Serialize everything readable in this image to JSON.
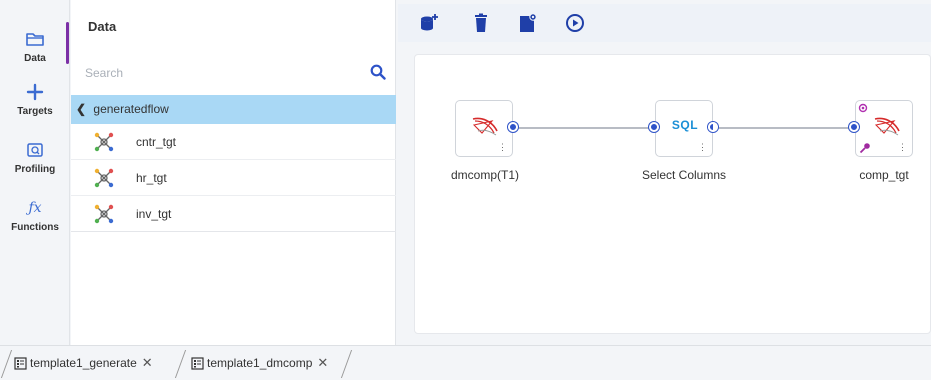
{
  "rail": {
    "items": [
      {
        "label": "Data",
        "icon": "folder-icon"
      },
      {
        "label": "Targets",
        "icon": "plus-icon"
      },
      {
        "label": "Profiling",
        "icon": "profiling-icon"
      },
      {
        "label": "Functions",
        "icon": "function-icon"
      }
    ],
    "function_glyph": "ƒx"
  },
  "panel": {
    "title": "Data",
    "search_placeholder": "Search",
    "flow": {
      "chevron": "❮",
      "name": "generatedflow"
    },
    "targets": [
      "cntr_tgt",
      "hr_tgt",
      "inv_tgt"
    ]
  },
  "toolbar": {
    "buttons": [
      "add-database-icon",
      "delete-icon",
      "database-settings-icon",
      "run-icon"
    ]
  },
  "canvas": {
    "nodes": [
      {
        "label": "dmcomp(T1)",
        "kind": "sql-server-source"
      },
      {
        "label": "Select Columns",
        "kind": "sql-transform",
        "badge": "SQL"
      },
      {
        "label": "comp_tgt",
        "kind": "sql-server-target"
      }
    ],
    "node_menu_glyph": "⋮"
  },
  "tabs": [
    {
      "label": "template1_generate",
      "close": "✕"
    },
    {
      "label": "template1_dmcomp",
      "close": "✕"
    }
  ],
  "colors": {
    "accent": "#7b2fa6",
    "primary": "#2e53c8",
    "selected_row": "#a9d8f5",
    "sql_text": "#1a8fd6"
  }
}
